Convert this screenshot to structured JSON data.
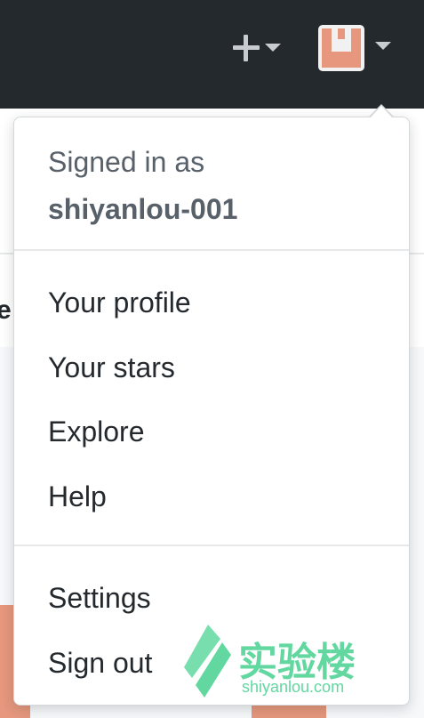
{
  "header": {
    "plus_icon": "plus-icon",
    "caret_icon": "caret-down-icon",
    "avatar_icon": "user-avatar"
  },
  "background": {
    "partial_letter": "e"
  },
  "dropdown": {
    "signed_in_label": "Signed in as",
    "username": "shiyanlou-001",
    "section_1": [
      {
        "label": "Your profile"
      },
      {
        "label": "Your stars"
      },
      {
        "label": "Explore"
      },
      {
        "label": "Help"
      }
    ],
    "section_2": [
      {
        "label": "Settings"
      },
      {
        "label": "Sign out"
      }
    ]
  },
  "watermark": {
    "brand_cn": "实验楼",
    "brand_url": "shiyanlou.com"
  },
  "colors": {
    "header_bg": "#24292e",
    "avatar_accent": "#e6977d",
    "watermark": "#62d8a0",
    "muted_text": "#586069",
    "text": "#24292e"
  }
}
